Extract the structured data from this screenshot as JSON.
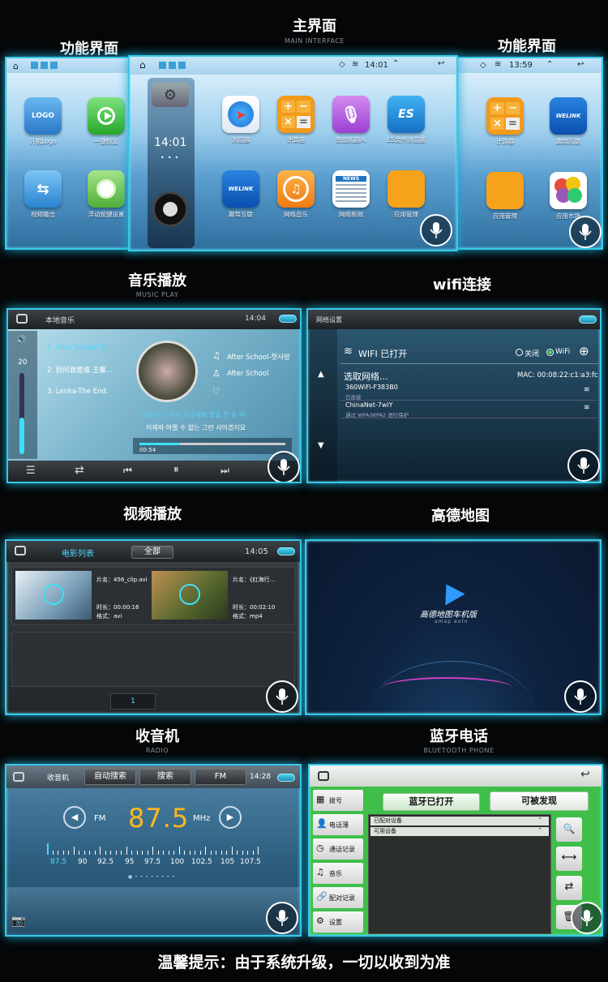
{
  "headers": {
    "main": {
      "title": "主界面",
      "sub": "MAIN INTERFACE"
    },
    "func_left": {
      "title": "功能界面"
    },
    "func_right": {
      "title": "功能界面"
    },
    "music": {
      "title": "音乐播放",
      "sub": "MUSIC PLAY"
    },
    "wifi": {
      "title": "wifi连接"
    },
    "video": {
      "title": "视频播放"
    },
    "map": {
      "title": "高德地图"
    },
    "radio": {
      "title": "收音机",
      "sub": "RADIO"
    },
    "bt": {
      "title": "蓝牙电话",
      "sub": "BLUETOOTH PHONE"
    }
  },
  "main_screen": {
    "time": "14:01",
    "clock": "14:01",
    "apps": [
      {
        "label": "浏览器"
      },
      {
        "label": "计算器"
      },
      {
        "label": "智能机器人"
      },
      {
        "label": "ES文件浏览器"
      },
      {
        "label": "趣驾互联"
      },
      {
        "label": "网络音乐"
      },
      {
        "label": "网络新闻"
      },
      {
        "label": "应用管理"
      }
    ],
    "news_tag": "NEWS",
    "welink_text": "WELINK",
    "es_text": "ES"
  },
  "left_screen": {
    "apps": [
      {
        "label": "开机Logo"
      },
      {
        "label": "一键恢复"
      },
      {
        "label": "视频输出"
      },
      {
        "label": "浮动按键设置"
      }
    ],
    "logo_text": "LOGO"
  },
  "right_screen": {
    "time": "13:59",
    "apps": [
      {
        "label": "计算器"
      },
      {
        "label": "趣驾互联"
      },
      {
        "label": "应用管理"
      },
      {
        "label": "应用市场"
      }
    ],
    "welink_text": "WELINK"
  },
  "music": {
    "title": "本地音乐",
    "time": "14:04",
    "volume": "20",
    "playlist": [
      "1. After School-첫...",
      "2. 别问我是谁 王馨...",
      "3. Lenka-The End."
    ],
    "song": "After School-첫사랑",
    "artist": "After School",
    "lyric1": "저를 나 소식이 궁금해봐 좋을 한 집 바",
    "lyric2": "이제와 어쩔 수 없는 그런 사이겠지요",
    "elapsed": "00:54",
    "progress": 0.28,
    "volume_level": 0.45
  },
  "wifi": {
    "title": "网络设置",
    "wifi_label": "WIFI 已打开",
    "off": "关闭",
    "on": "WiFi",
    "select": "选取网络...",
    "mac": "MAC: 00:08:22:c1:a3:fc",
    "networks": [
      {
        "name": "360WiFi-F383B0",
        "status": "已连接"
      },
      {
        "name": "ChinaNet-7wiY",
        "status": "通过 WPA/WPA2 进行保护"
      }
    ]
  },
  "video": {
    "title": "电影列表",
    "filter": "全部",
    "time": "14:05",
    "items": [
      {
        "name": "片名：456_clip.avi",
        "duration": "时长：00:00:16",
        "format": "格式：avi"
      },
      {
        "name": "片名：《红海行...",
        "duration": "时长：00:02:10",
        "format": "格式：mp4"
      }
    ],
    "page": "1"
  },
  "map": {
    "app_name": "高德地图车机版",
    "app_sub": "amap  auto"
  },
  "radio": {
    "title": "收音机",
    "auto_search": "自动搜索",
    "search": "搜索",
    "band": "FM",
    "time": "14:28",
    "band_label": "FM",
    "freq": "87.5",
    "unit": "MHz",
    "scale": [
      "87.5",
      "90",
      "92.5",
      "95",
      "97.5",
      "100",
      "102.5",
      "105",
      "107.5"
    ]
  },
  "bt": {
    "menu": [
      "拨号",
      "电话薄",
      "通话记录",
      "音乐",
      "配对记录",
      "设置"
    ],
    "bt_on": "蓝牙已打开",
    "discoverable": "可被发现",
    "paired": "已配对设备",
    "available": "可用设备"
  },
  "footer": "温馨提示：由于系统升级，一切以收到为准",
  "colors": {
    "accent": "#37c9e8",
    "green": "#3fbf4a",
    "cyan_text": "#4fd6ff"
  }
}
